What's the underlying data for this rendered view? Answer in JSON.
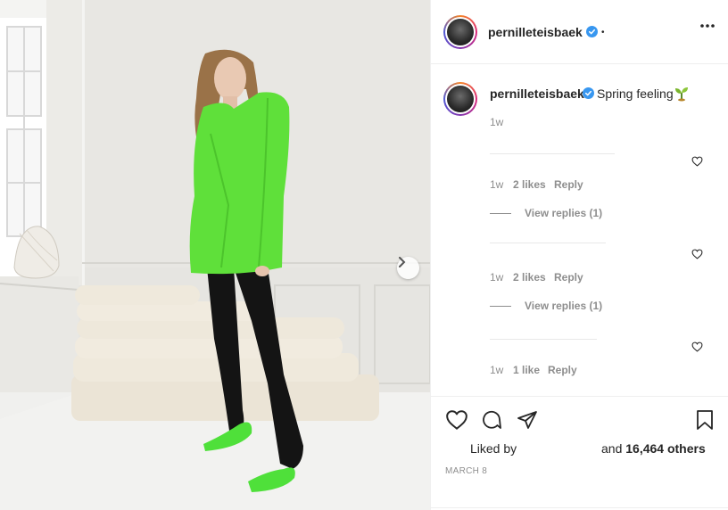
{
  "post": {
    "username": "pernilleteisbaek",
    "header_dot": "•",
    "caption": "Spring feeling",
    "caption_time": "1w"
  },
  "comments": [
    {
      "time": "1w",
      "likes": "2 likes",
      "reply": "Reply",
      "view_replies": "View replies (1)"
    },
    {
      "time": "1w",
      "likes": "2 likes",
      "reply": "Reply",
      "view_replies": "View replies (1)"
    },
    {
      "time": "1w",
      "likes": "1 like",
      "reply": "Reply"
    }
  ],
  "likes": {
    "liked_by_prefix": "Liked by",
    "and_text": "and",
    "count": "16,464 others"
  },
  "date": "MARCH 8",
  "colors": {
    "verified": "#3897f0",
    "blazer": "#5fe03a",
    "shoes": "#4fe03a"
  },
  "icons": {
    "verified": "verified-badge-icon",
    "more": "more-options-icon",
    "like": "heart-icon",
    "comment": "comment-icon",
    "share": "share-icon",
    "save": "bookmark-icon",
    "next": "chevron-right-icon",
    "plant": "seedling-icon"
  }
}
